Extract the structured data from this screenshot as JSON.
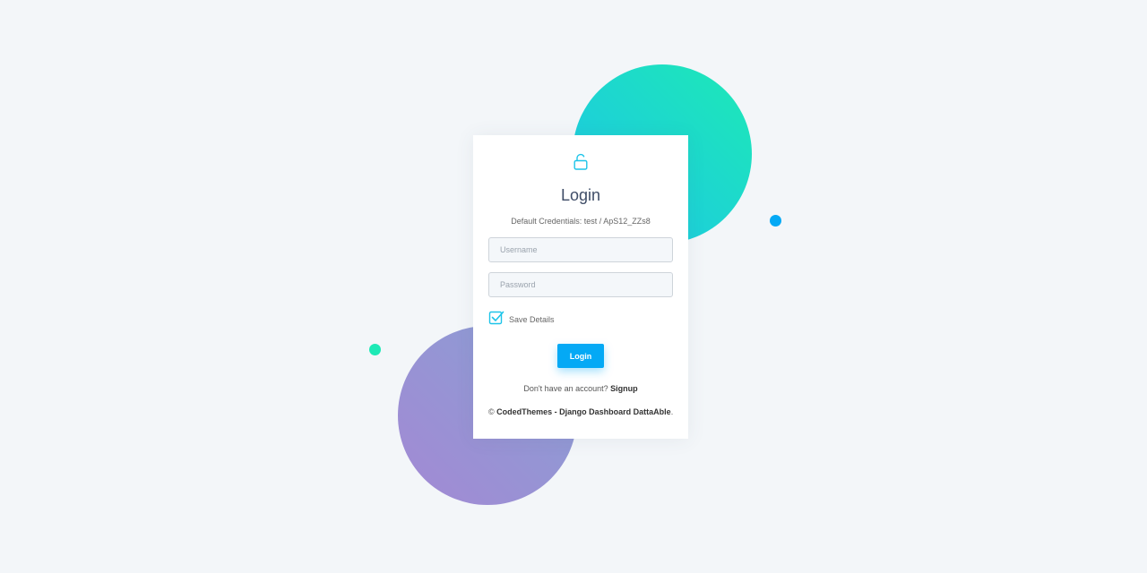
{
  "colors": {
    "background": "#f3f6f9",
    "accent_teal": "#1de9b6",
    "accent_blue": "#04a9f5",
    "accent_purple": "#a389d4"
  },
  "login_card": {
    "icon": "unlock-icon",
    "title": "Login",
    "credentials_note": "Default Credentials: test / ApS12_ZZs8",
    "username": {
      "placeholder": "Username",
      "value": ""
    },
    "password": {
      "placeholder": "Password",
      "value": ""
    },
    "save_details": {
      "label": "Save Details",
      "checked": true
    },
    "login_button_label": "Login",
    "signup_prompt": "Don't have an account?",
    "signup_link_label": "Signup",
    "footer": {
      "copyright": "©",
      "link_text": "CodedThemes - Django Dashboard DattaAble",
      "suffix": "."
    }
  }
}
